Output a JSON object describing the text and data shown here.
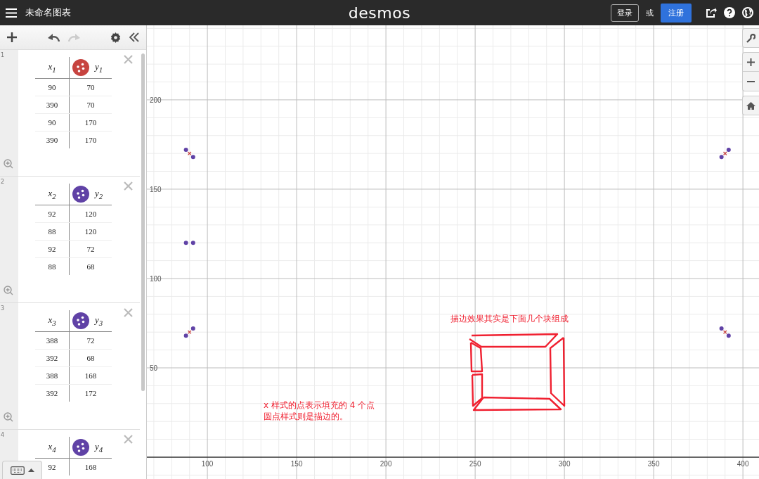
{
  "header": {
    "title": "未命名图表",
    "logo": "desmos",
    "login": "登录",
    "or": "或",
    "signup": "注册"
  },
  "expressions": [
    {
      "number": "1",
      "color": "#c74440",
      "x_header": "x$_{1}$",
      "y_header": "y$_{1}$",
      "rows": [
        [
          "90",
          "70"
        ],
        [
          "390",
          "70"
        ],
        [
          "90",
          "170"
        ],
        [
          "390",
          "170"
        ]
      ]
    },
    {
      "number": "2",
      "color": "#6042a6",
      "x_header": "x$_{2}$",
      "y_header": "y$_{2}$",
      "rows": [
        [
          "92",
          "120"
        ],
        [
          "88",
          "120"
        ],
        [
          "92",
          "72"
        ],
        [
          "88",
          "68"
        ]
      ]
    },
    {
      "number": "3",
      "color": "#6042a6",
      "x_header": "x$_{3}$",
      "y_header": "y$_{3}$",
      "rows": [
        [
          "388",
          "72"
        ],
        [
          "392",
          "68"
        ],
        [
          "388",
          "168"
        ],
        [
          "392",
          "172"
        ]
      ]
    },
    {
      "number": "4",
      "color": "#6042a6",
      "x_header": "x$_{4}$",
      "y_header": "y$_{4}$",
      "rows": [
        [
          "92",
          "168"
        ]
      ]
    }
  ],
  "graph": {
    "chart_data": {
      "type": "scatter",
      "grid": true,
      "xlim": [
        66.1,
        409.4
      ],
      "ylim": [
        -12.2,
        241.7
      ],
      "xticks": [
        100,
        150,
        200,
        250,
        300,
        350,
        400
      ],
      "yticks": [
        50,
        100,
        150,
        200
      ],
      "series": [
        {
          "color": "#c74440",
          "marker": "cross",
          "x": [
            90,
            390,
            90,
            390
          ],
          "values": [
            70,
            70,
            170,
            170
          ]
        },
        {
          "color": "#6042a6",
          "marker": "circle",
          "x": [
            92,
            88,
            92,
            88
          ],
          "values": [
            120,
            120,
            72,
            68
          ]
        },
        {
          "color": "#6042a6",
          "marker": "circle",
          "x": [
            388,
            392,
            388,
            392
          ],
          "values": [
            72,
            68,
            168,
            172
          ]
        },
        {
          "color": "#6042a6",
          "marker": "circle",
          "x": [
            92,
            88
          ],
          "values": [
            168,
            172
          ]
        }
      ]
    }
  },
  "annotations": [
    "描边效果其实是下面几个块组成",
    "x 样式的点表示填充的 4 个点",
    "圆点样式则是描边的。"
  ]
}
